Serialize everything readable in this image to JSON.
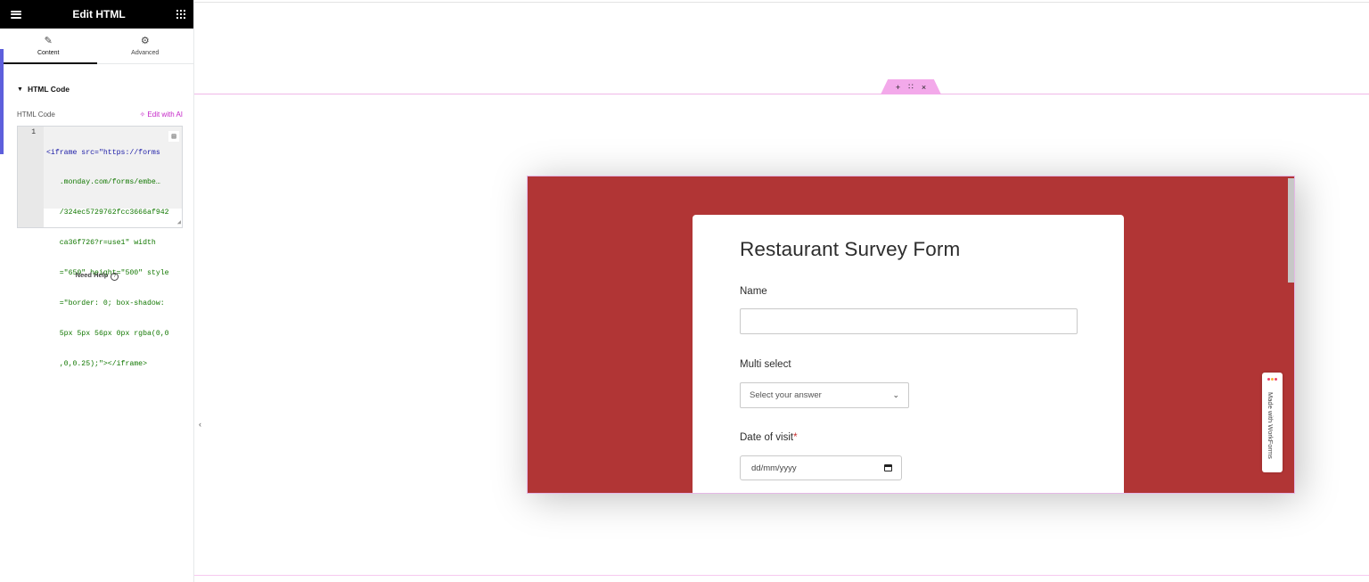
{
  "panel": {
    "title": "Edit HTML",
    "tabs": [
      {
        "label": "Content",
        "icon": "pencil-icon"
      },
      {
        "label": "Advanced",
        "icon": "gear-icon"
      }
    ],
    "section_title": "HTML Code",
    "code_label": "HTML Code",
    "edit_ai_label": "✧ Edit with AI",
    "code": {
      "line_number": "1",
      "lines": [
        "<iframe src=\"https://forms",
        "   .monday.com/forms/embe…",
        "   /324ec5729762fcc3666af942",
        "   ca36f726?r=use1\" width",
        "   =\"650\" height=\"500\" style",
        "   =\"border: 0; box-shadow:",
        "   5px 5px 56px 0px rgba(0,0",
        "   ,0,0.25);\"></iframe>"
      ]
    },
    "need_help_label": "Need Help",
    "accent_color": "#5d5fdc"
  },
  "canvas": {
    "section_handle": {
      "add": "+",
      "drag": "∷",
      "close": "×"
    },
    "embed_bg_color": "#b13535",
    "form": {
      "title": "Restaurant Survey Form",
      "questions": [
        {
          "label": "Name",
          "type": "text",
          "value": ""
        },
        {
          "label": "Multi select",
          "type": "select",
          "placeholder": "Select your answer"
        },
        {
          "label": "Date of visit",
          "required_marker": "*",
          "type": "date",
          "placeholder": "dd/mm/yyyy"
        }
      ]
    },
    "badge_text": "Made with WorkForms"
  }
}
